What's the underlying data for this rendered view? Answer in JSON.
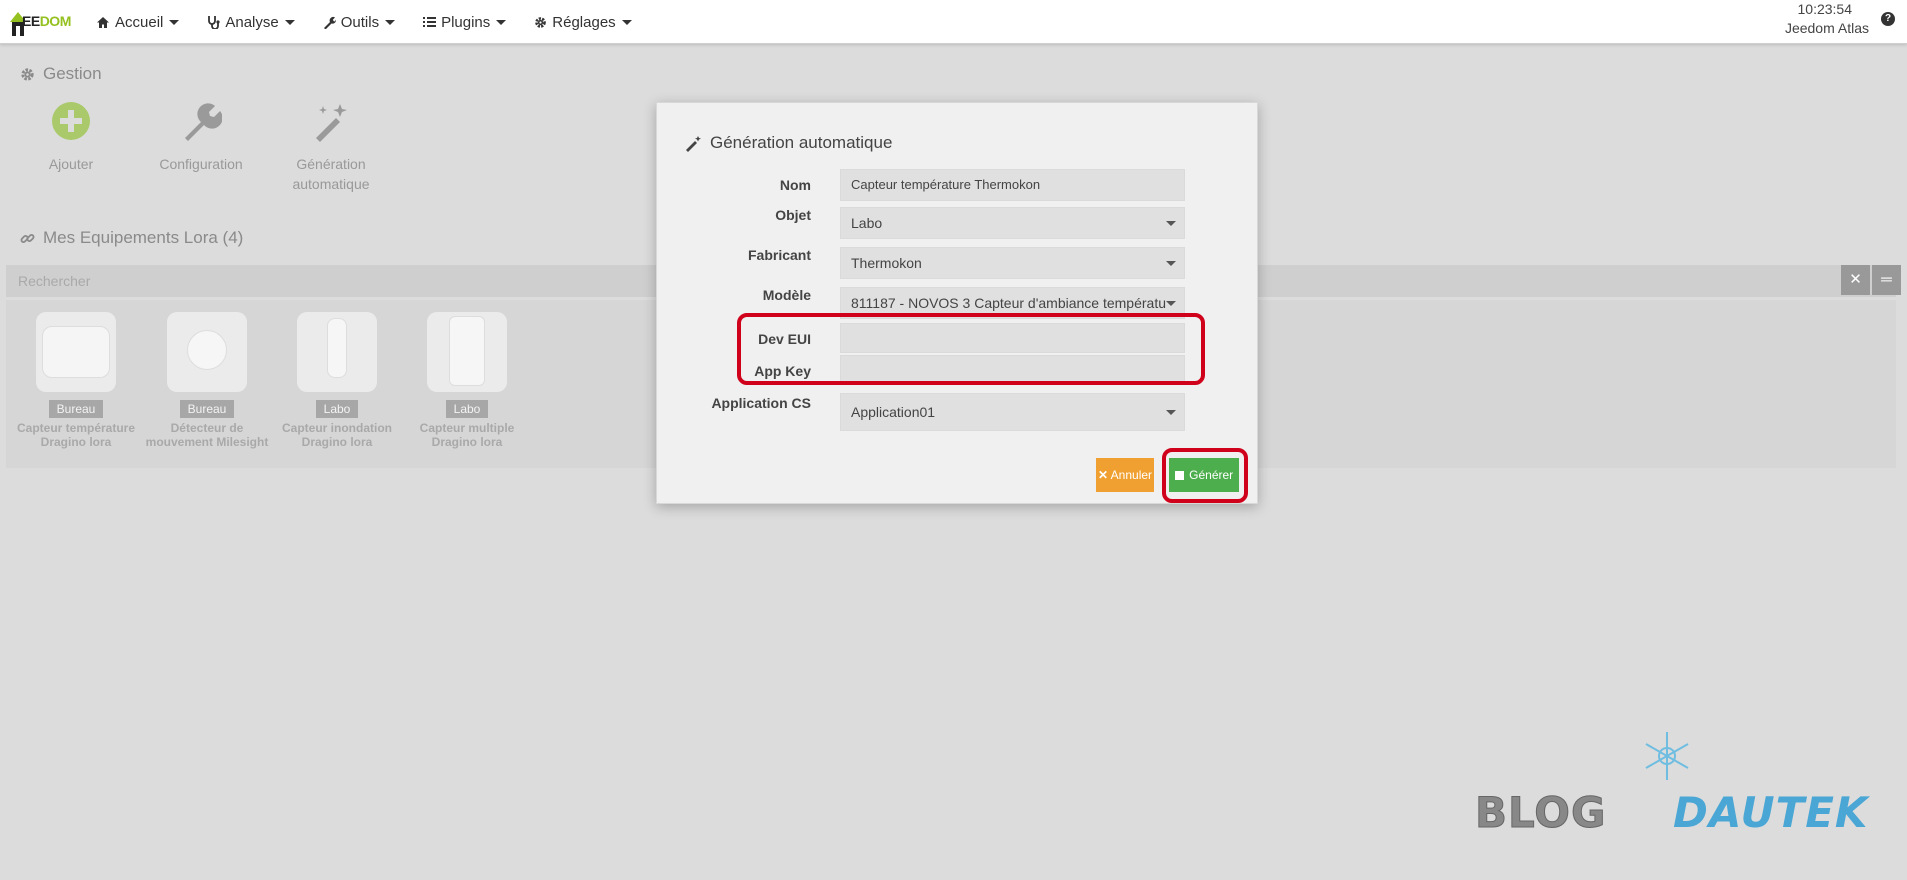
{
  "navbar": {
    "logo_prefix": "EE",
    "logo_suffix": "DOM",
    "menu": [
      {
        "label": "Accueil",
        "icon": "home-icon"
      },
      {
        "label": "Analyse",
        "icon": "stethoscope-icon"
      },
      {
        "label": "Outils",
        "icon": "wrench-icon"
      },
      {
        "label": "Plugins",
        "icon": "list-icon"
      },
      {
        "label": "Réglages",
        "icon": "gear-icon"
      }
    ],
    "time": "10:23:54",
    "user": "Jeedom Atlas",
    "help_glyph": "?"
  },
  "gestion": {
    "title": "Gestion",
    "tiles": [
      {
        "label": "Ajouter"
      },
      {
        "label": "Configuration"
      },
      {
        "label_line1": "Génération",
        "label_line2": "automatique"
      }
    ]
  },
  "equipements": {
    "title": "Mes Equipements Lora (4)",
    "search_placeholder": "Rechercher",
    "items": [
      {
        "room": "Bureau",
        "name_line1": "Capteur température",
        "name_line2": "Dragino lora"
      },
      {
        "room": "Bureau",
        "name_line1": "Détecteur de",
        "name_line2": "mouvement Milesight"
      },
      {
        "room": "Labo",
        "name_line1": "Capteur inondation",
        "name_line2": "Dragino lora"
      },
      {
        "room": "Labo",
        "name_line1": "Capteur multiple",
        "name_line2": "Dragino lora"
      }
    ]
  },
  "modal": {
    "title": "Génération automatique",
    "fields": {
      "nom_label": "Nom",
      "nom_value": "Capteur température Thermokon",
      "objet_label": "Objet",
      "objet_value": "Labo",
      "fabricant_label": "Fabricant",
      "fabricant_value": "Thermokon",
      "modele_label": "Modèle",
      "modele_value": "811187 - NOVOS 3 Capteur d'ambiance températu",
      "deveui_label": "Dev EUI",
      "deveui_value": "",
      "appkey_label": "App Key",
      "appkey_value": "",
      "appcs_label": "Application CS",
      "appcs_value": "Application01"
    },
    "cancel_label": "Annuler",
    "generate_label": "Générer"
  },
  "watermark": {
    "part1": "BLOG",
    "part2": "DAUTEK"
  },
  "colors": {
    "accent_green": "#94c11f",
    "highlight_red": "#d0021b",
    "cancel_orange": "#f0a030",
    "generate_green": "#4cae4c"
  }
}
